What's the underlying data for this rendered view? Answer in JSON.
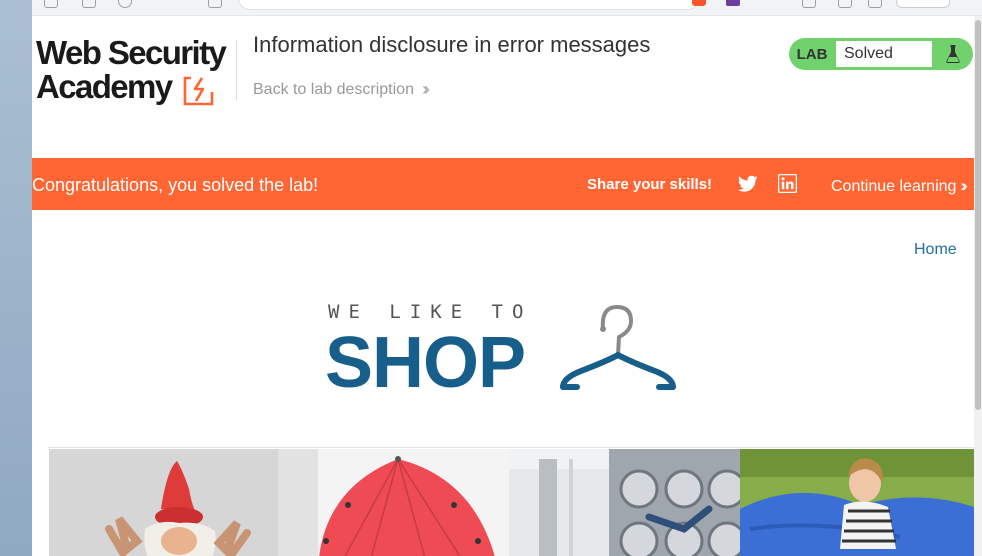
{
  "lab": {
    "title": "Information disclosure in error messages",
    "back_link": "Back to lab description",
    "status_tag": "LAB",
    "status": "Solved"
  },
  "logo": {
    "line1": "Web Security",
    "line2": "Academy"
  },
  "banner": {
    "message": "Congratulations, you solved the lab!",
    "share_label": "Share your skills!",
    "continue_label": "Continue learning"
  },
  "nav": {
    "home": "Home"
  },
  "shop_logo": {
    "tagline": "WE LIKE TO",
    "word": "SHOP"
  },
  "colors": {
    "banner": "#ff6633",
    "lab_status": "#70d16d",
    "shop_blue": "#175f8a",
    "link_blue": "#1f6fa8"
  },
  "icons": [
    "twitter-icon",
    "linkedin-icon",
    "flask-icon",
    "hanger-icon",
    "chevron-right-icon"
  ]
}
